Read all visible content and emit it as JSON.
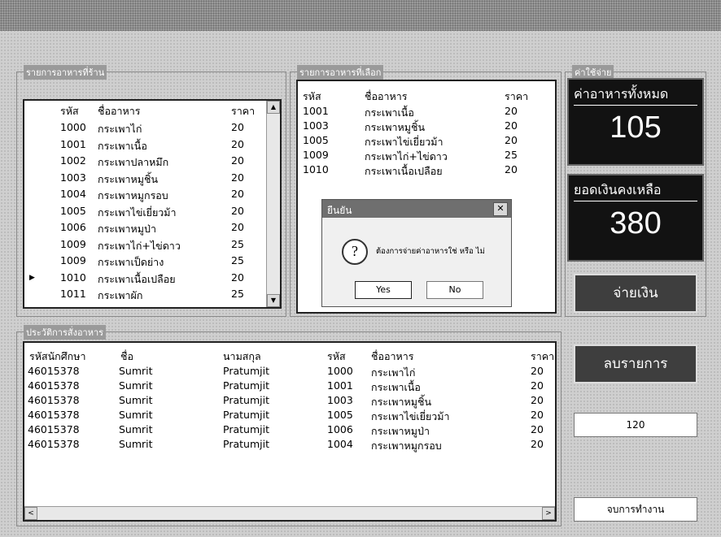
{
  "window": {
    "title": ""
  },
  "menu_panel": {
    "legend": "รายการอาหารที่ร้าน",
    "columns": [
      "รหัส",
      "ชื่ออาหาร",
      "ราคา"
    ],
    "rows": [
      [
        "1000",
        "กระเพาไก่",
        "20"
      ],
      [
        "1001",
        "กระเพาเนื้อ",
        "20"
      ],
      [
        "1002",
        "กระเพาปลาหมึก",
        "20"
      ],
      [
        "1003",
        "กระเพาหมูชิ้น",
        "20"
      ],
      [
        "1004",
        "กระเพาหมูกรอบ",
        "20"
      ],
      [
        "1005",
        "กระเพาไข่เยี่ยวม้า",
        "20"
      ],
      [
        "1006",
        "กระเพาหมูป่า",
        "20"
      ],
      [
        "1009",
        "กระเพาไก่+ไข่ดาว",
        "25"
      ],
      [
        "1009",
        "กระเพาเป็ดย่าง",
        "25"
      ],
      [
        "1010",
        "กระเพาเนื้อเปลือย",
        "20"
      ],
      [
        "1011",
        "กระเพาผัก",
        "25"
      ]
    ],
    "row_indicator": "▶"
  },
  "selected_panel": {
    "legend": "รายการอาหารที่เลือก",
    "columns": [
      "รหัส",
      "ชื่ออาหาร",
      "ราคา"
    ],
    "rows": [
      [
        "1001",
        "กระเพาเนื้อ",
        "20"
      ],
      [
        "1003",
        "กระเพาหมูชิ้น",
        "20"
      ],
      [
        "1005",
        "กระเพาไข่เยี่ยวม้า",
        "20"
      ],
      [
        "1009",
        "กระเพาไก่+ไข่ดาว",
        "25"
      ],
      [
        "1010",
        "กระเพาเนื้อเปลือย",
        "20"
      ]
    ]
  },
  "dialog": {
    "title": "ยืนยัน",
    "message": "ต้องการจ่ายค่าอาหารใช่ หรือ ไม่",
    "yes": "Yes",
    "no": "No",
    "close": "✕",
    "icon": "?"
  },
  "expense_panel": {
    "legend": "ค่าใช้จ่าย",
    "total_label": "ค่าอาหารทั้งหมด",
    "total_value": "105",
    "balance_label": "ยอดเงินคงเหลือ",
    "balance_value": "380",
    "pay_button": "จ่ายเงิน"
  },
  "history_panel": {
    "legend": "ประวัติการสั่งอาหาร",
    "columns": [
      "รหัสนักศึกษา",
      "ชื่อ",
      "นามสกุล",
      "รหัส",
      "ชื่ออาหาร",
      "ราคา"
    ],
    "rows": [
      [
        "46015378",
        "Sumrit",
        "Pratumjit",
        "1000",
        "กระเพาไก่",
        "20"
      ],
      [
        "46015378",
        "Sumrit",
        "Pratumjit",
        "1001",
        "กระเพาเนื้อ",
        "20"
      ],
      [
        "46015378",
        "Sumrit",
        "Pratumjit",
        "1003",
        "กระเพาหมูชิ้น",
        "20"
      ],
      [
        "46015378",
        "Sumrit",
        "Pratumjit",
        "1005",
        "กระเพาไข่เยี่ยวม้า",
        "20"
      ],
      [
        "46015378",
        "Sumrit",
        "Pratumjit",
        "1006",
        "กระเพาหมูป่า",
        "20"
      ],
      [
        "46015378",
        "Sumrit",
        "Pratumjit",
        "1004",
        "กระเพาหมูกรอบ",
        "20"
      ]
    ]
  },
  "side_controls": {
    "delete_button": "ลบรายการ",
    "budget_value": "120",
    "end_button": "จบการทำงาน",
    "scroll_left": "<",
    "scroll_right": ">",
    "scroll_up": "▲",
    "scroll_down": "▼"
  }
}
